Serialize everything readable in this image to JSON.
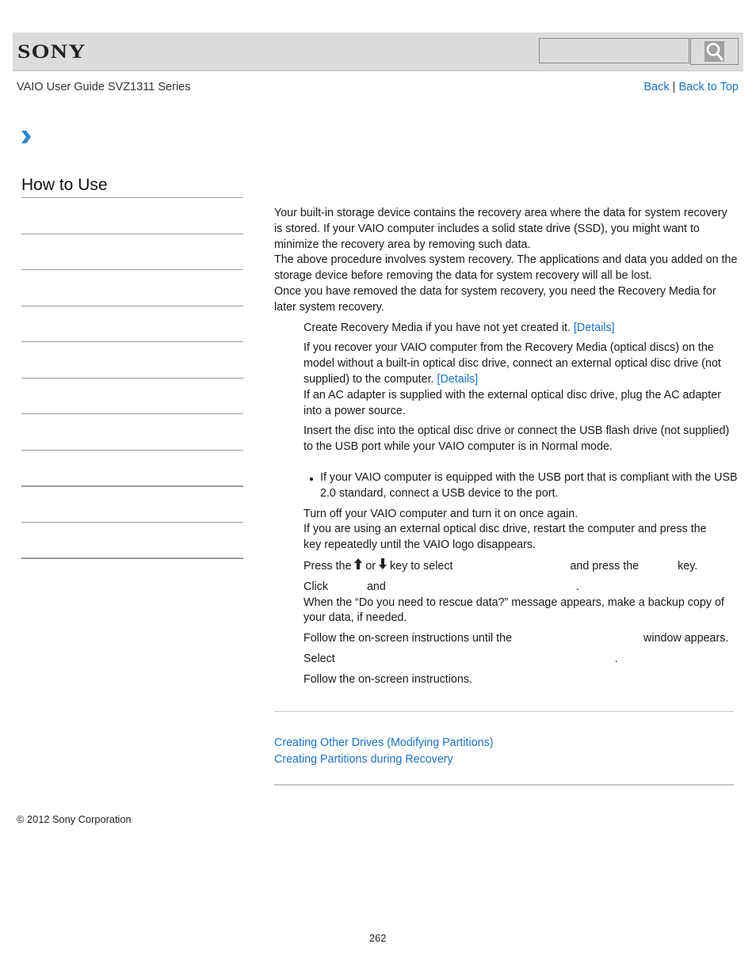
{
  "header": {
    "brand": "SONY",
    "search": {
      "placeholder": "",
      "value": "",
      "button_icon": "search-icon"
    },
    "guide_title": "VAIO User Guide SVZ1311 Series",
    "nav": {
      "back": "Back",
      "separator": "|",
      "back_to_top": "Back to Top"
    }
  },
  "breadcrumb": {
    "icon": "chevron-right-icon"
  },
  "sidebar": {
    "title": "How to Use",
    "item_count": 10
  },
  "main": {
    "intro": [
      "Your built-in storage device contains the recovery area where the data for system recovery is stored. If your VAIO computer includes a solid state drive (SSD), you might want to minimize the recovery area by removing such data.",
      "The above procedure involves system recovery. The applications and data you added on the storage device before removing the data for system recovery will all be lost.",
      "Once you have removed the data for system recovery, you need the Recovery Media for later system recovery."
    ],
    "steps": {
      "s1": {
        "text": "Create Recovery Media if you have not yet created it. ",
        "link": "[Details]"
      },
      "s2": {
        "text": "If you recover your VAIO computer from the Recovery Media (optical discs) on the model without a built-in optical disc drive, connect an external optical disc drive (not supplied) to the computer. ",
        "link": "[Details]",
        "note": "If an AC adapter is supplied with the external optical disc drive, plug the AC adapter into a power source."
      },
      "s3": {
        "text": "Insert the disc into the optical disc drive or connect the USB flash drive (not supplied) to the USB port while your VAIO computer is in Normal mode.",
        "bullet": "If your VAIO computer is equipped with the USB port that is compliant with the USB 2.0 standard, connect a USB device to the port."
      },
      "s4": {
        "text": "Turn off your VAIO computer and turn it on once again.",
        "note": "If you are using an external optical disc drive, restart the computer and press the",
        "note2": "key repeatedly until the VAIO logo disappears."
      },
      "s5": {
        "part1": "Press the ",
        "up_icon": "↑",
        "or": " or ",
        "down_icon": "↓",
        "part2": " key to select",
        "part3": "and press the",
        "part4": "key."
      },
      "s6": {
        "part1": "Click",
        "part2": "and",
        "part3": ".",
        "note": "When the “Do you need to rescue data?” message appears, make a backup copy of your data, if needed."
      },
      "s7": {
        "part1": "Follow the on-screen instructions until the",
        "part2": "window appears."
      },
      "s8": {
        "part1": "Select",
        "part2": "."
      },
      "s9": {
        "text": "Follow the on-screen instructions."
      }
    }
  },
  "related_links": [
    "Creating Other Drives (Modifying Partitions)",
    "Creating Partitions during Recovery"
  ],
  "footer": {
    "copyright": "© 2012 Sony Corporation",
    "page_number": "262"
  },
  "colors": {
    "link": "#1a73c6",
    "header_bg": "#dcdcdc",
    "chevron": "#2a86d0"
  }
}
